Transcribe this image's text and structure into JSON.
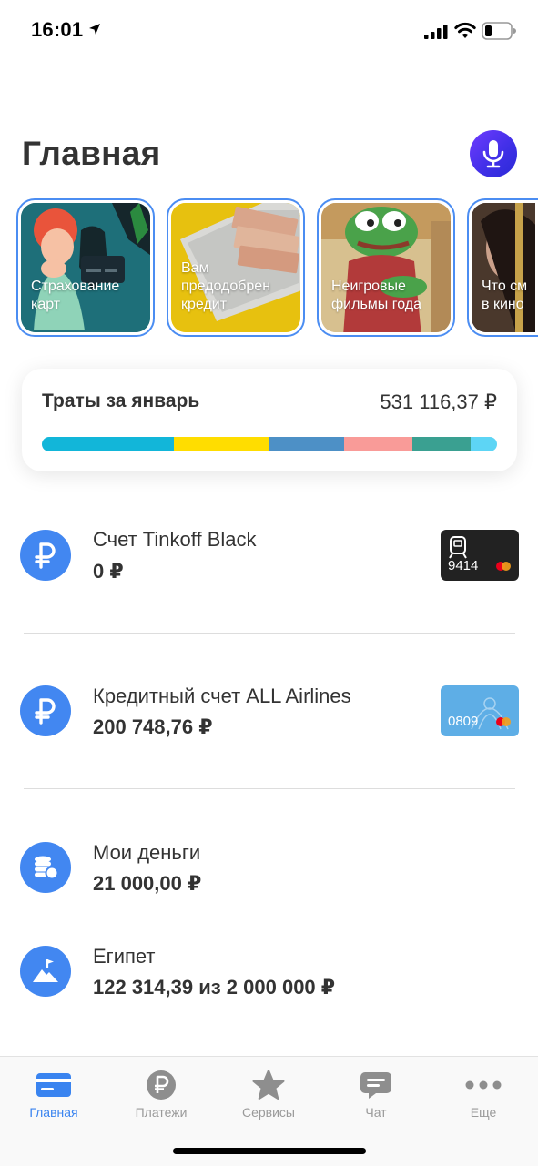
{
  "status_bar": {
    "time": "16:01"
  },
  "header": {
    "title": "Главная"
  },
  "stories": [
    {
      "label_line1": "Страхование",
      "label_line2": "карт"
    },
    {
      "label_line1": "Вам",
      "label_line2": "предодобрен",
      "label_line3": "кредит"
    },
    {
      "label_line1": "Неигровые",
      "label_line2": "фильмы года"
    },
    {
      "label_line1": "Что см",
      "label_line2": "в кино"
    }
  ],
  "spending": {
    "title": "Траты за январь",
    "amount": "531 116,37 ₽",
    "segments": [
      {
        "color": "#12b6d9",
        "fraction": 0.289
      },
      {
        "color": "#ffdd00",
        "fraction": 0.208
      },
      {
        "color": "#4d90c6",
        "fraction": 0.166
      },
      {
        "color": "#f99b98",
        "fraction": 0.15
      },
      {
        "color": "#3aa091",
        "fraction": 0.129
      },
      {
        "color": "#5dd5f5",
        "fraction": 0.058
      }
    ]
  },
  "accounts": [
    {
      "name": "Счет Tinkoff Black",
      "balance": "0 ₽",
      "card_number": "9414"
    },
    {
      "name": "Кредитный счет ALL Airlines",
      "balance": "200 748,76 ₽",
      "card_number": "0809"
    },
    {
      "name": "Мои деньги",
      "balance": "21 000,00 ₽"
    },
    {
      "name": "Египет",
      "balance": "122 314,39 из 2 000 000 ₽"
    }
  ],
  "tabs": [
    {
      "label": "Главная",
      "icon": "card-icon"
    },
    {
      "label": "Платежи",
      "icon": "ruble-icon"
    },
    {
      "label": "Сервисы",
      "icon": "star-icon"
    },
    {
      "label": "Чат",
      "icon": "chat-icon"
    },
    {
      "label": "Еще",
      "icon": "more-icon"
    }
  ],
  "colors": {
    "accent": "#3a84f0",
    "icon_bg": "#4287f1",
    "mic_gradient_start": "#6f3bff",
    "mic_gradient_end": "#2a2ad6"
  }
}
